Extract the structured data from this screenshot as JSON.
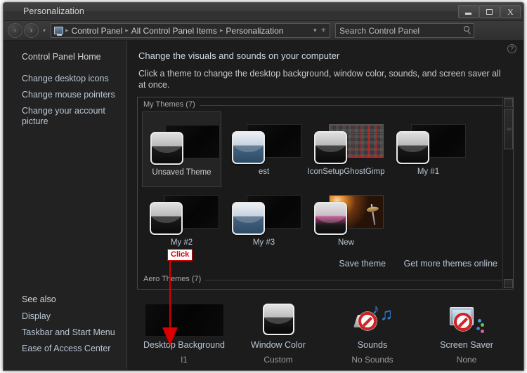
{
  "window": {
    "title": "Personalization",
    "buttons": {
      "minimize": "minimize-icon",
      "maximize": "maximize-icon",
      "close": "X"
    }
  },
  "addressbar": {
    "back": "‹",
    "forward": "›",
    "history_caret": "▾",
    "computer_icon": "computer-icon",
    "breadcrumbs": [
      "Control Panel",
      "All Control Panel Items",
      "Personalization"
    ],
    "separator": "▸",
    "dropdown": "▾",
    "refresh": "✳",
    "search_placeholder": "Search Control Panel",
    "search_value": ""
  },
  "sidebar": {
    "home": "Control Panel Home",
    "items": [
      "Change desktop icons",
      "Change mouse pointers",
      "Change your account picture"
    ],
    "see_also_heading": "See also",
    "see_also_items": [
      "Display",
      "Taskbar and Start Menu",
      "Ease of Access Center"
    ]
  },
  "content": {
    "help": "?",
    "heading": "Change the visuals and sounds on your computer",
    "subheading": "Click a theme to change the desktop background, window color, sounds, and screen saver all at once."
  },
  "themes_panel": {
    "my_themes_label": "My Themes (7)",
    "aero_themes_label": "Aero Themes (7)",
    "themes": [
      {
        "name": "Unsaved Theme",
        "selected": true,
        "wallpaper": "dark",
        "preview": "dark"
      },
      {
        "name": "est",
        "selected": false,
        "wallpaper": "dark",
        "preview": "blue"
      },
      {
        "name": "IconSetupGhostGimp",
        "selected": false,
        "wallpaper": "plaid",
        "preview": "dark"
      },
      {
        "name": "My #1",
        "selected": false,
        "wallpaper": "dark",
        "preview": "dark"
      },
      {
        "name": "My #2",
        "selected": false,
        "wallpaper": "dark",
        "preview": "dark"
      },
      {
        "name": "My #3",
        "selected": false,
        "wallpaper": "dark",
        "preview": "blue"
      },
      {
        "name": "New",
        "selected": false,
        "wallpaper": "seattle",
        "preview": "pinkish"
      }
    ],
    "save_theme": "Save theme",
    "get_more": "Get more themes online",
    "scrollbar": {
      "up": "▴",
      "down": "▾"
    }
  },
  "options": [
    {
      "label": "Desktop Background",
      "value": "l1",
      "icon": "wallpaper-thumbnail"
    },
    {
      "label": "Window Color",
      "value": "Custom",
      "icon": "window-color-icon"
    },
    {
      "label": "Sounds",
      "value": "No Sounds",
      "icon": "sounds-muted-icon"
    },
    {
      "label": "Screen Saver",
      "value": "None",
      "icon": "screen-saver-none-icon"
    }
  ],
  "annotation": {
    "label": "Click",
    "color": "#d80000"
  }
}
